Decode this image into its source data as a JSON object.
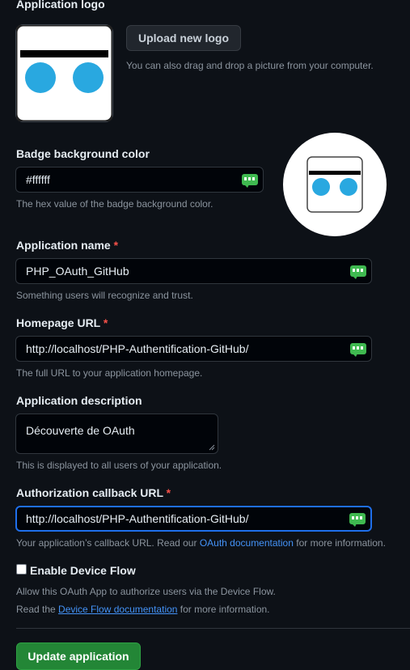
{
  "logo": {
    "label": "Application logo",
    "upload_button": "Upload new logo",
    "drag_hint": "You can also drag and drop a picture from your computer."
  },
  "badge": {
    "label": "Badge background color",
    "value": "#ffffff",
    "hint": "The hex value of the badge background color."
  },
  "app_name": {
    "label": "Application name",
    "required": "*",
    "value": "PHP_OAuth_GitHub",
    "hint": "Something users will recognize and trust."
  },
  "homepage": {
    "label": "Homepage URL",
    "required": "*",
    "value": "http://localhost/PHP-Authentification-GitHub/",
    "hint": "The full URL to your application homepage."
  },
  "description": {
    "label": "Application description",
    "value": "Découverte de OAuth",
    "hint": "This is displayed to all users of your application."
  },
  "callback": {
    "label": "Authorization callback URL",
    "required": "*",
    "value": "http://localhost/PHP-Authentification-GitHub/",
    "hint_before": "Your application’s callback URL. Read our",
    "hint_link": "OAuth documentation",
    "hint_after": "for more information."
  },
  "device_flow": {
    "label": "Enable Device Flow",
    "checked": false,
    "desc": "Allow this OAuth App to authorize users via the Device Flow.",
    "read_before": "Read the",
    "read_link": "Device Flow documentation",
    "read_after": "for more information."
  },
  "update_button": "Update application",
  "icons": {
    "logo": "robot-eyes-logo",
    "password_manager": "password-manager-badge-icon"
  },
  "colors": {
    "accent": "#4493f8",
    "primary": "#238636",
    "required": "#f85149",
    "logo_eye": "#29a8e0"
  }
}
